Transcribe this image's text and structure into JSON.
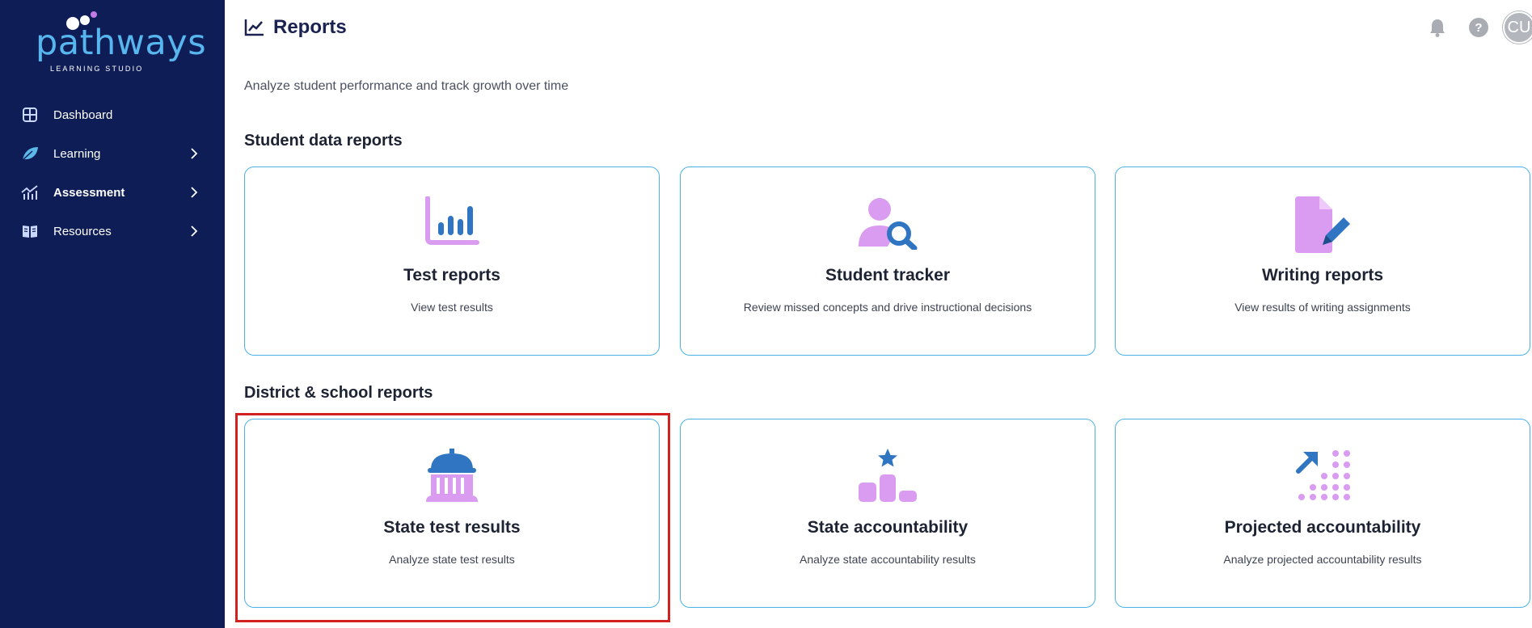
{
  "brand": {
    "logo_text": "pathways",
    "logo_sub": "LEARNING STUDIO"
  },
  "sidebar": {
    "items": [
      {
        "label": "Dashboard",
        "icon": "dashboard-grid-icon",
        "bold": false
      },
      {
        "label": "Learning",
        "icon": "leaf-icon",
        "bold": false
      },
      {
        "label": "Assessment",
        "icon": "chart-icon",
        "bold": true
      },
      {
        "label": "Resources",
        "icon": "book-icon",
        "bold": false
      }
    ]
  },
  "header": {
    "title": "Reports",
    "help_label": "?",
    "avatar_initials": "CU"
  },
  "main": {
    "subtitle": "Analyze student performance and track growth over time",
    "student_section": {
      "title": "Student data reports",
      "cards": [
        {
          "title": "Test reports",
          "desc": "View test results",
          "icon": "bar-chart-icon"
        },
        {
          "title": "Student tracker",
          "desc": "Review missed concepts and drive instructional decisions",
          "icon": "student-search-icon"
        },
        {
          "title": "Writing reports",
          "desc": "View results of writing assignments",
          "icon": "document-pen-icon"
        }
      ]
    },
    "district_section": {
      "title": "District & school reports",
      "cards": [
        {
          "title": "State test results",
          "desc": "Analyze state test results",
          "icon": "capitol-building-icon"
        },
        {
          "title": "State accountability",
          "desc": "Analyze state accountability results",
          "icon": "podium-star-icon"
        },
        {
          "title": "Projected accountability",
          "desc": "Analyze projected accountability results",
          "icon": "projection-dots-icon"
        }
      ]
    }
  },
  "colors": {
    "sidebar_bg": "#0f1d57",
    "card_border": "#4bb0e8",
    "icon_purple": "#d99cf0",
    "icon_blue": "#2f75c2",
    "highlight": "#d32020"
  }
}
